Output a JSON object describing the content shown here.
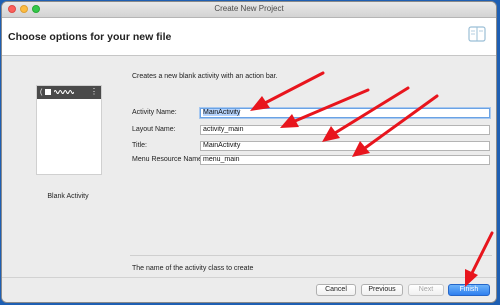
{
  "window": {
    "title": "Create New Project"
  },
  "header": {
    "title": "Choose options for your new file",
    "icon": "device-icon"
  },
  "template": {
    "name": "Blank Activity",
    "preview_back": "(",
    "preview_menu": "⋮"
  },
  "form": {
    "description": "Creates a new blank activity with an action bar.",
    "fields": [
      {
        "label": "Activity Name:",
        "value": "MainActivity",
        "focused": true
      },
      {
        "label": "Layout Name:",
        "value": "activity_main"
      },
      {
        "label": "Title:",
        "value": "MainActivity"
      },
      {
        "label": "Menu Resource Name:",
        "value": "menu_main"
      }
    ],
    "help_text": "The name of the activity class to create"
  },
  "buttons": {
    "cancel": "Cancel",
    "previous": "Previous",
    "next": "Next",
    "finish": "Finish"
  },
  "colors": {
    "annotation_arrow": "#e8151d",
    "primary_button": "#3a86f2",
    "desktop_background": "#1e5fb3"
  }
}
